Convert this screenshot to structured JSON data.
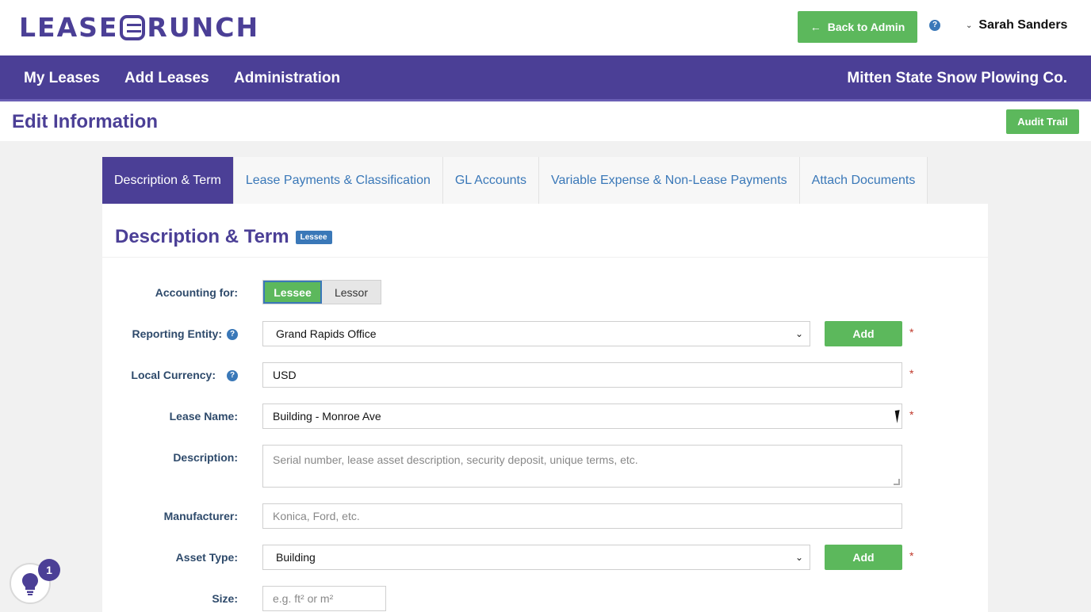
{
  "brand": {
    "logo_left": "LEASE",
    "logo_right": "RUNCH"
  },
  "top": {
    "back_label": "Back to Admin",
    "help": "?",
    "user_name": "Sarah Sanders"
  },
  "nav": {
    "items": [
      "My Leases",
      "Add Leases",
      "Administration"
    ],
    "company": "Mitten State Snow Plowing Co."
  },
  "page": {
    "title": "Edit Information",
    "audit_label": "Audit Trail"
  },
  "tabs": [
    "Description & Term",
    "Lease Payments & Classification",
    "GL Accounts",
    "Variable Expense & Non-Lease Payments",
    "Attach Documents"
  ],
  "section": {
    "title": "Description & Term",
    "badge": "Lessee"
  },
  "form": {
    "accounting_for": {
      "label": "Accounting for:",
      "options": [
        "Lessee",
        "Lessor"
      ],
      "selected": "Lessee"
    },
    "reporting_entity": {
      "label": "Reporting Entity:",
      "value": "Grand Rapids Office",
      "add_label": "Add"
    },
    "local_currency": {
      "label": "Local Currency:",
      "value": "USD"
    },
    "lease_name": {
      "label": "Lease Name:",
      "value": "Building - Monroe Ave"
    },
    "description": {
      "label": "Description:",
      "placeholder": "Serial number, lease asset description, security deposit, unique terms, etc."
    },
    "manufacturer": {
      "label": "Manufacturer:",
      "placeholder": "Konica, Ford, etc."
    },
    "asset_type": {
      "label": "Asset Type:",
      "value": "Building",
      "add_label": "Add"
    },
    "size": {
      "label": "Size:",
      "placeholder": "e.g. ft² or m²"
    },
    "required_mark": "*"
  },
  "widget": {
    "count": "1"
  }
}
